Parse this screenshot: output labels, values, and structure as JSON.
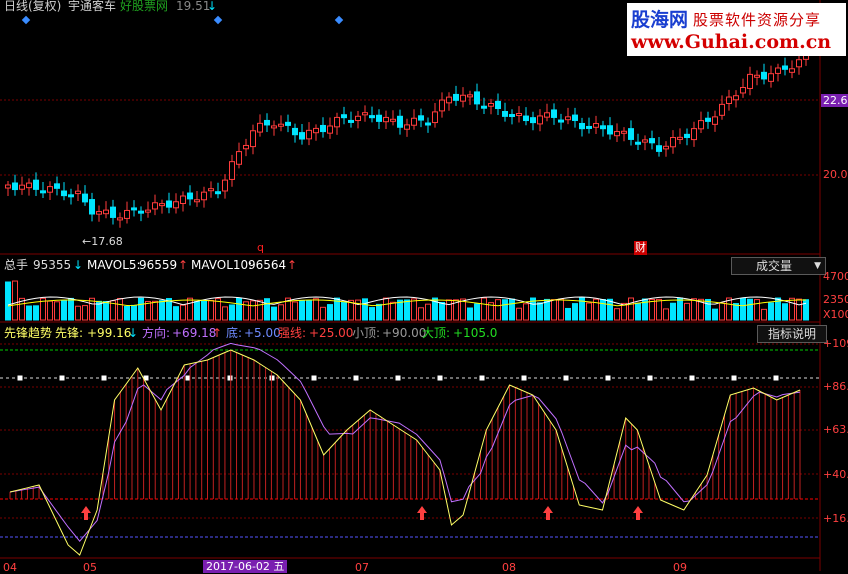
{
  "header": {
    "period": "日线(复权)",
    "stock_name": "宇通客车",
    "watermark": "好股票网",
    "price": "19.51",
    "price_arrow": "↓",
    "low_marker": "←17.68",
    "event_q": "q",
    "event_cai": "财"
  },
  "price_axis": {
    "labels": [
      "22.6",
      "20.0"
    ]
  },
  "volume_panel": {
    "title": "总手",
    "total": "95355",
    "total_arrow": "↓",
    "mavol5_label": "MAVOL5:",
    "mavol5": "96559",
    "mavol5_arrow": "↑",
    "mavol10_label": "MAVOL10:",
    "mavol10": "96564",
    "mavol10_arrow": "↑",
    "dropdown_label": "成交量",
    "axis_labels": [
      "4700",
      "2350",
      "X100"
    ]
  },
  "indicator_panel": {
    "name": "先锋趋势",
    "xianfeng_label": "先锋:",
    "xianfeng": "+99.16",
    "xianfeng_arrow": "↓",
    "fangxiang_label": "方向:",
    "fangxiang": "+69.18",
    "fangxiang_arrow": "↑",
    "di_label": "底:",
    "di": "+5.00",
    "qiangxian_label": "强线:",
    "qiangxian": "+25.00",
    "xiaoding_label": "小顶:",
    "xiaoding": "+90.00",
    "dading_label": "大顶:",
    "dading": "+105.0",
    "help_button": "指标说明",
    "axis_labels": [
      "+109",
      "+86.",
      "+63.",
      "+40.",
      "+16."
    ]
  },
  "date_axis": {
    "labels": [
      "04",
      "05",
      "2017-06-02 五",
      "07",
      "08",
      "09"
    ]
  },
  "logo": {
    "text_cn": "股海网",
    "slogan": "股票软件资源分享",
    "url": "www.Guhai.com.cn"
  },
  "colors": {
    "up": "#ff3c3c",
    "down": "#00e5ff",
    "grid": "#7a0000",
    "mavol5": "#ffffff",
    "mavol10": "#ffff00",
    "xianfeng": "#ffff66",
    "fangxiang": "#c070ff",
    "dading_line": "#00cc00",
    "di_line": "#5555ff",
    "accent": "#ff0000"
  }
}
